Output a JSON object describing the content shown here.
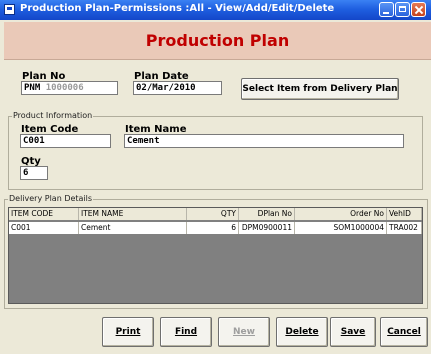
{
  "window": {
    "title": "Production Plan-Permissions :All - View/Add/Edit/Delete",
    "minimize_icon": "minimize-icon",
    "maximize_icon": "maximize-icon",
    "close_icon": "close-icon"
  },
  "header": {
    "title": "Production Plan"
  },
  "plan": {
    "plan_no_label": "Plan No",
    "plan_no_prefix": "PNM",
    "plan_no_value": "1000006",
    "plan_date_label": "Plan Date",
    "plan_date_value": "02/Mar/2010",
    "select_button": "Select Item from Delivery Plan"
  },
  "product": {
    "group_label": "Product Information",
    "item_code_label": "Item Code",
    "item_code_value": "C001",
    "item_name_label": "Item Name",
    "item_name_value": "Cement",
    "qty_label": "Qty",
    "qty_value": "6"
  },
  "delivery": {
    "group_label": "Delivery Plan Details",
    "columns": [
      "ITEM CODE",
      "ITEM NAME",
      "QTY",
      "DPlan No",
      "Order No",
      "VehID"
    ],
    "rows": [
      [
        "C001",
        "Cement",
        "6",
        "DPM0900011",
        "SOM1000004",
        "TRA002"
      ]
    ]
  },
  "buttons": {
    "print": "Print",
    "find": "Find",
    "new": "New",
    "delete": "Delete",
    "save": "Save",
    "cancel": "Cancel"
  },
  "colors": {
    "title_bar": "#1f5fe0",
    "header_bg": "#eac9b8",
    "header_text": "#c00000",
    "window_bg": "#ece9d8"
  }
}
